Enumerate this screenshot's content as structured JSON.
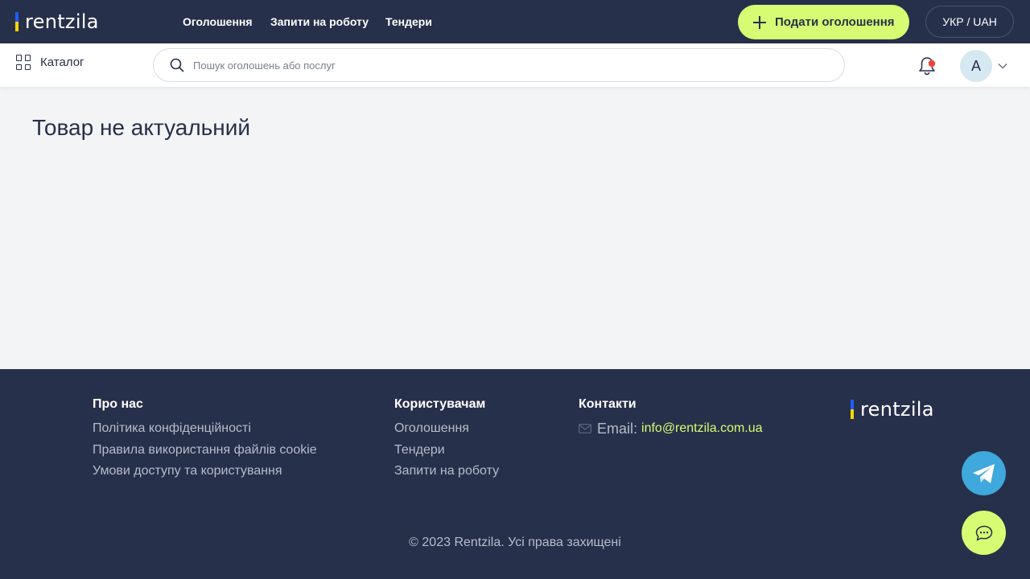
{
  "header": {
    "logo_text": "rentzila",
    "nav": [
      "Оголошення",
      "Запити на роботу",
      "Тендери"
    ],
    "add_button_label": "Подати оголошення",
    "language_currency": "УКР / UAH"
  },
  "subbar": {
    "catalog_label": "Каталог",
    "search_placeholder": "Пошук оголошень або послуг",
    "avatar_initial": "A",
    "notification_dot_color": "#f04438"
  },
  "main": {
    "title": "Товар не актуальний"
  },
  "footer": {
    "about": {
      "heading": "Про нас",
      "links": [
        "Політика конфіденційності",
        "Правила використання файлів cookie",
        "Умови доступу та користування"
      ]
    },
    "users": {
      "heading": "Користувачам",
      "links": [
        "Оголошення",
        "Тендери",
        "Запити на роботу"
      ]
    },
    "contacts": {
      "heading": "Контакти",
      "email_label": "Email:",
      "email": "info@rentzila.com.ua"
    },
    "logo_text": "rentzila",
    "copyright": "© 2023 Rentzila. Усі права захищені"
  },
  "colors": {
    "navy": "#27304a",
    "accent_lime": "#d7fc73",
    "telegram_blue": "#3fa8dc"
  },
  "icons": [
    "grid-icon",
    "search-icon",
    "bell-icon",
    "chevron-down-icon",
    "envelope-icon",
    "telegram-icon",
    "chat-icon",
    "plus-icon"
  ]
}
